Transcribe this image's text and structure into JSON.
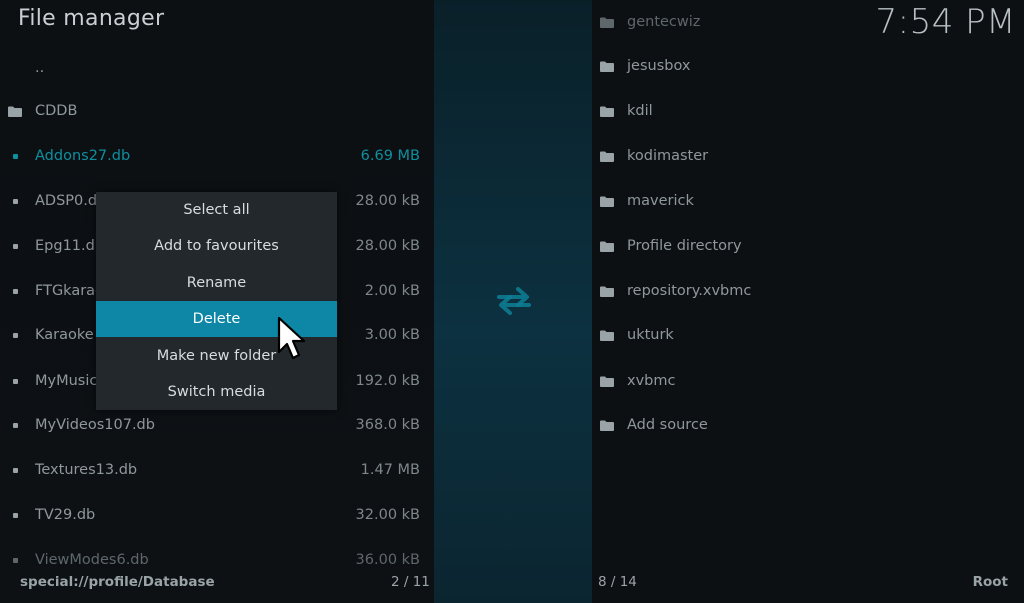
{
  "header": {
    "title": "File manager",
    "clock": "7:54 PM"
  },
  "left_pane": {
    "items": [
      {
        "name": "..",
        "size": "",
        "icon": "none"
      },
      {
        "name": "CDDB",
        "size": "",
        "icon": "folder-icon"
      },
      {
        "name": "Addons27.db",
        "size": "6.69 MB",
        "icon": "file-icon",
        "highlight": true
      },
      {
        "name": "ADSP0.db",
        "size": "28.00 kB",
        "icon": "file-icon"
      },
      {
        "name": "Epg11.db",
        "size": "28.00 kB",
        "icon": "file-icon"
      },
      {
        "name": "FTGkaraoke",
        "size": "2.00 kB",
        "icon": "file-icon"
      },
      {
        "name": "Karaoke",
        "size": "3.00 kB",
        "icon": "file-icon"
      },
      {
        "name": "MyMusic",
        "size": "192.0 kB",
        "icon": "file-icon"
      },
      {
        "name": "MyVideos107.db",
        "size": "368.0 kB",
        "icon": "file-icon"
      },
      {
        "name": "Textures13.db",
        "size": "1.47 MB",
        "icon": "file-icon"
      },
      {
        "name": "TV29.db",
        "size": "32.00 kB",
        "icon": "file-icon"
      },
      {
        "name": "ViewModes6.db",
        "size": "36.00 kB",
        "icon": "file-icon",
        "dim": true
      }
    ],
    "path": "special://profile/Database",
    "count": "2 / 11"
  },
  "right_pane": {
    "items": [
      {
        "name": "gentecwiz",
        "icon": "folder-icon",
        "dim": true
      },
      {
        "name": "jesusbox",
        "icon": "folder-icon"
      },
      {
        "name": "kdil",
        "icon": "folder-icon"
      },
      {
        "name": "kodimaster",
        "icon": "folder-icon"
      },
      {
        "name": "maverick",
        "icon": "folder-icon"
      },
      {
        "name": "Profile directory",
        "icon": "folder-icon"
      },
      {
        "name": "repository.xvbmc",
        "icon": "folder-icon"
      },
      {
        "name": "ukturk",
        "icon": "folder-icon"
      },
      {
        "name": "xvbmc",
        "icon": "folder-icon"
      },
      {
        "name": "Add source",
        "icon": "folder-icon"
      }
    ],
    "count": "8 / 14",
    "path": "Root"
  },
  "context_menu": {
    "items": [
      {
        "label": "Select all"
      },
      {
        "label": "Add to favourites"
      },
      {
        "label": "Rename"
      },
      {
        "label": "Delete",
        "active": true
      },
      {
        "label": "Make new folder"
      },
      {
        "label": "Switch media"
      }
    ]
  },
  "colors": {
    "accent": "#0e86a6",
    "highlight_text": "#0f8f9e",
    "menu_bg": "#22282b"
  },
  "icons": {
    "swap": "swap-arrows-icon",
    "cursor": "mouse-cursor-icon"
  }
}
